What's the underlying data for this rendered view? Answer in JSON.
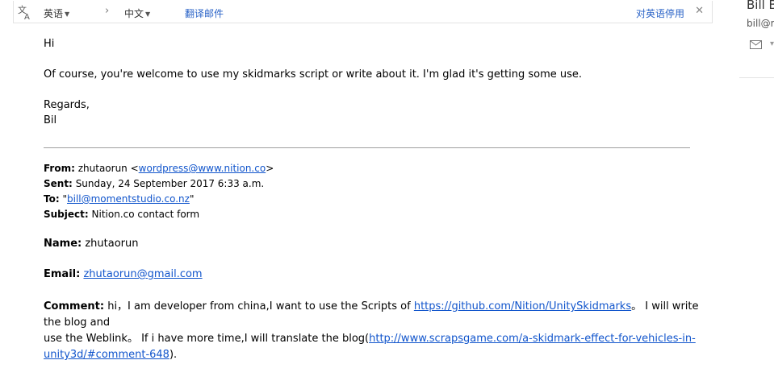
{
  "translate_bar": {
    "source_lang": "英语",
    "target_lang": "中文",
    "translate_link": "翻译邮件",
    "stop_link": "对英语停用"
  },
  "contact": {
    "name": "Bill B",
    "email": "bill@m"
  },
  "reply": {
    "greeting": "Hi",
    "body": "Of course, you're welcome to use my skidmarks script or write about it. I'm glad it's getting some use.",
    "signoff": "Regards,",
    "signature": "Bil"
  },
  "quoted_header": {
    "from_label": "From:",
    "from_name": "zhutaorun <",
    "from_email": "wordpress@www.nition.co",
    "from_end": ">",
    "sent_label": "Sent:",
    "sent_value": "Sunday, 24 September 2017 6:33 a.m.",
    "to_label": "To:",
    "to_prefix": "\"",
    "to_email": "bill@momentstudio.co.nz",
    "to_suffix": "\"",
    "subject_label": "Subject:",
    "subject_value": "Nition.co contact form"
  },
  "form_fields": {
    "name_label": "Name:",
    "name_value": "zhutaorun",
    "email_label": "Email:",
    "email_value": "zhutaorun@gmail.com",
    "comment_label": "Comment:",
    "comment_text1": "hi，I am developer from china,I want to use the Scripts of ",
    "comment_link1": "https://github.com/Nition/UnitySkidmarks",
    "comment_text2": "。 I will write the blog and",
    "comment_text3": "use the Weblink。 If i have more time,I will translate the blog(",
    "comment_link2": "http://www.scrapsgame.com/a-skidmark-effect-for-vehicles-in-unity3d/#comment-648",
    "comment_text4": ")."
  }
}
